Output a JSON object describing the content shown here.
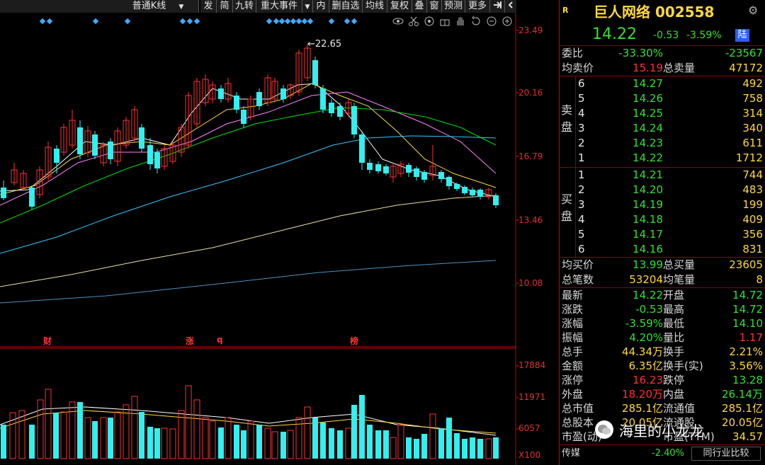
{
  "toolbar": {
    "items": [
      "普通K线",
      "发",
      "简",
      "九转",
      "重大事件",
      "内",
      "删自选",
      "均线",
      "复权",
      "叠",
      "窗",
      "预测",
      "更多"
    ],
    "dropdown_marks": [
      "▼",
      "▼"
    ]
  },
  "chart": {
    "price_axis": [
      "23.49",
      "20.16",
      "16.79",
      "13.46",
      "10.08"
    ],
    "high_label": "22.65",
    "events": [
      "财",
      "涨",
      "q",
      "榜"
    ],
    "volume_axis": [
      "17884",
      "11971",
      "6057"
    ],
    "volume_unit": "X100",
    "colors": {
      "up": "#ff3030",
      "down": "#30f0f0",
      "ma5": "#ffffff",
      "ma10": "#ffd83c",
      "ma20": "#ff80ff",
      "ma30": "#00e000",
      "ma60": "#30c8ff",
      "ma120": "#e8e0a0",
      "ma250": "#4a90c0"
    }
  },
  "panel": {
    "r_mark": "R",
    "title": "巨人网络 002558",
    "price": "14.22",
    "change": "-0.53",
    "change_pct": "-3.59%",
    "badge": "陆",
    "weibi_label": "委比",
    "weibi_pct": "-33.30%",
    "weibi_diff": "-23567",
    "avg_sell_label": "均卖价",
    "avg_sell": "15.19",
    "total_sell_label": "总卖量",
    "total_sell": "47172",
    "sell_side": "卖盘",
    "buy_side": "买盘",
    "sells": [
      {
        "lv": "6",
        "price": "14.27",
        "vol": "492"
      },
      {
        "lv": "5",
        "price": "14.26",
        "vol": "758"
      },
      {
        "lv": "4",
        "price": "14.25",
        "vol": "314"
      },
      {
        "lv": "3",
        "price": "14.24",
        "vol": "340"
      },
      {
        "lv": "2",
        "price": "14.23",
        "vol": "611"
      },
      {
        "lv": "1",
        "price": "14.22",
        "vol": "1712"
      }
    ],
    "buys": [
      {
        "lv": "1",
        "price": "14.21",
        "vol": "744"
      },
      {
        "lv": "2",
        "price": "14.20",
        "vol": "483"
      },
      {
        "lv": "3",
        "price": "14.19",
        "vol": "199"
      },
      {
        "lv": "4",
        "price": "14.18",
        "vol": "409"
      },
      {
        "lv": "5",
        "price": "14.17",
        "vol": "356"
      },
      {
        "lv": "6",
        "price": "14.16",
        "vol": "831"
      }
    ],
    "avg_buy_label": "均买价",
    "avg_buy": "13.99",
    "total_buy_label": "总买量",
    "total_buy": "23605",
    "total_trades_label": "总笔数",
    "total_trades": "53204",
    "avg_trade_label": "均笔量",
    "avg_trade": "8",
    "stats": [
      {
        "l1": "最新",
        "v1": "14.22",
        "c1": "green",
        "l2": "开盘",
        "v2": "14.72",
        "c2": "green"
      },
      {
        "l1": "涨跌",
        "v1": "-0.53",
        "c1": "green",
        "l2": "最高",
        "v2": "14.72",
        "c2": "green"
      },
      {
        "l1": "涨幅",
        "v1": "-3.59%",
        "c1": "green",
        "l2": "最低",
        "v2": "14.10",
        "c2": "green"
      },
      {
        "l1": "振幅",
        "v1": "4.20%",
        "c1": "green",
        "l2": "量比",
        "v2": "1.17",
        "c2": "red"
      },
      {
        "l1": "总手",
        "v1": "44.34万",
        "c1": "yellow",
        "l2": "换手",
        "v2": "2.21%",
        "c2": "yellow"
      },
      {
        "l1": "金额",
        "v1": "6.35亿",
        "c1": "yellow",
        "l2": "换手(实)",
        "v2": "3.56%",
        "c2": "yellow"
      },
      {
        "l1": "涨停",
        "v1": "16.23",
        "c1": "red",
        "l2": "跌停",
        "v2": "13.28",
        "c2": "green"
      },
      {
        "l1": "外盘",
        "v1": "18.20万",
        "c1": "red",
        "l2": "内盘",
        "v2": "26.14万",
        "c2": "green"
      },
      {
        "l1": "总市值",
        "v1": "285.1亿",
        "c1": "yellow",
        "l2": "流通值",
        "v2": "285.1亿",
        "c2": "yellow"
      },
      {
        "l1": "总股本",
        "v1": "20.05亿",
        "c1": "yellow",
        "l2": "流通股",
        "v2": "20.05亿",
        "c2": "yellow"
      },
      {
        "l1": "市盈(动)",
        "v1": "",
        "c1": "yellow",
        "l2": "市盈(TTM)",
        "v2": "34.57",
        "c2": "yellow"
      }
    ],
    "sector": "传媒",
    "sector_pct": "-2.40%",
    "compare": "同行业比较"
  },
  "watermark": "海里的小龙龙"
}
